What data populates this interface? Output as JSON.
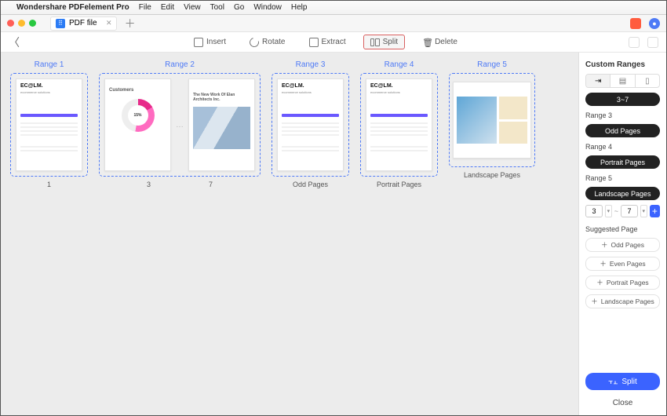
{
  "menubar": {
    "app_name": "Wondershare PDFelement Pro",
    "menus": [
      "File",
      "Edit",
      "View",
      "Tool",
      "Go",
      "Window",
      "Help"
    ]
  },
  "tabs": {
    "active_label": "PDF file"
  },
  "toolbar": {
    "insert": "Insert",
    "rotate": "Rotate",
    "extract": "Extract",
    "split": "Split",
    "delete": "Delete"
  },
  "ranges": [
    {
      "title": "Range 1",
      "caption": "1",
      "thumbs": [
        "invoice"
      ]
    },
    {
      "title": "Range 2",
      "caption_left": "3",
      "caption_right": "7",
      "thumbs": [
        "customers",
        "architects"
      ]
    },
    {
      "title": "Range 3",
      "caption": "Odd Pages",
      "thumbs": [
        "invoice"
      ]
    },
    {
      "title": "Range 4",
      "caption": "Portrait Pages",
      "thumbs": [
        "invoice"
      ]
    },
    {
      "title": "Range 5",
      "caption": "Landscape Pages",
      "thumbs": [
        "landscape"
      ]
    }
  ],
  "thumb_text": {
    "logo": "EC@LM.",
    "tagline": "ecommerce solutions",
    "customers": "Customers",
    "donut_pct": "15%",
    "arch_title": "The New Work Of Elan Architects Inc."
  },
  "sidebar": {
    "title": "Custom Ranges",
    "chip": "3~7",
    "group3_label": "Range 3",
    "group3_btn": "Odd Pages",
    "group4_label": "Range 4",
    "group4_btn": "Portrait Pages",
    "group5_label": "Range 5",
    "group5_btn": "Landscape Pages",
    "from": "3",
    "to": "7",
    "suggested_title": "Suggested Page",
    "sugg1": "Odd Pages",
    "sugg2": "Even Pages",
    "sugg3": "Portrait Pages",
    "sugg4": "Landscape Pages",
    "apply": "Split",
    "close": "Close"
  }
}
